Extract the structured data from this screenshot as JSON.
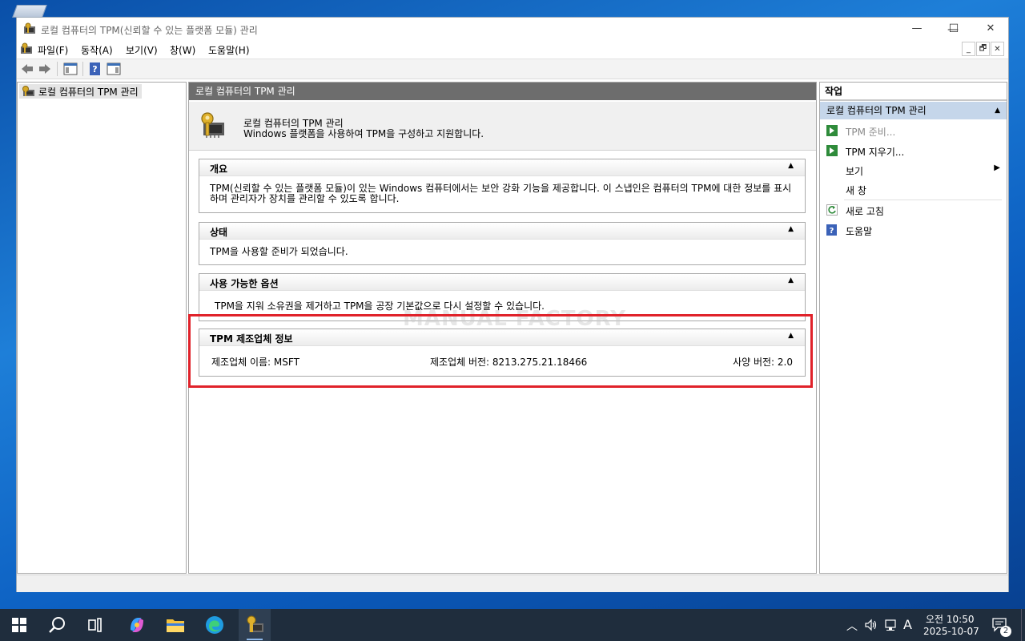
{
  "window": {
    "title": "로컬 컴퓨터의 TPM(신뢰할 수 있는 플랫폼 모듈) 관리",
    "minimize": "—",
    "maximize": "☐",
    "close": "✕"
  },
  "menu": {
    "items": [
      "파일(F)",
      "동작(A)",
      "보기(V)",
      "창(W)",
      "도움말(H)"
    ]
  },
  "tree": {
    "root_label": "로컬 컴퓨터의 TPM 관리"
  },
  "center": {
    "header": "로컬 컴퓨터의 TPM 관리",
    "intro_title": "로컬 컴퓨터의 TPM 관리",
    "intro_desc": "Windows 플랫폼을 사용하여 TPM을 구성하고 지원합니다.",
    "overview_title": "개요",
    "overview_text": "TPM(신뢰할 수 있는 플랫폼 모듈)이 있는 Windows 컴퓨터에서는 보안 강화 기능을 제공합니다. 이 스냅인은 컴퓨터의 TPM에 대한 정보를 표시하며 관리자가 장치를 관리할 수 있도록 합니다.",
    "status_title": "상태",
    "status_text": "TPM을 사용할 준비가 되었습니다.",
    "options_title": "사용 가능한 옵션",
    "options_text": "TPM을 지워 소유권을 제거하고 TPM을 공장 기본값으로 다시 설정할 수 있습니다.",
    "mfr_title": "TPM 제조업체 정보",
    "mfr_name": "제조업체 이름: MSFT",
    "mfr_version": "제조업체 버전: 8213.275.21.18466",
    "spec_version": "사양 버전: 2.0",
    "watermark": "MANUAL FACTORY"
  },
  "actions": {
    "header": "작업",
    "group": "로컬 컴퓨터의 TPM 관리",
    "prepare": "TPM 준비...",
    "clear": "TPM 지우기...",
    "view": "보기",
    "new_window": "새 창",
    "refresh": "새로 고침",
    "help": "도움말"
  },
  "taskbar": {
    "time": "오전 10:50",
    "date": "2025-10-07",
    "ime": "A",
    "notification_count": "2"
  },
  "colors": {
    "highlight": "#e0222a",
    "actions_group_bg": "#c5d6ea",
    "center_header_bg": "#6d6d6d"
  }
}
